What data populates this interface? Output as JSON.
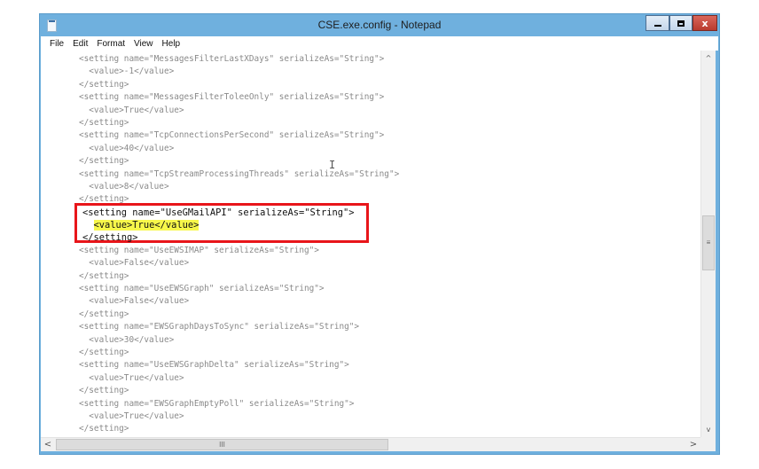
{
  "window": {
    "title": "CSE.exe.config - Notepad",
    "controls": {
      "minimize": "_",
      "maximize": "□",
      "close": "x"
    }
  },
  "menu": [
    "File",
    "Edit",
    "Format",
    "View",
    "Help"
  ],
  "editor": {
    "lines": [
      "<setting name=\"MessagesFilterLastXDays\" serializeAs=\"String\">",
      "  <value>-1</value>",
      "</setting>",
      "<setting name=\"MessagesFilterToleeOnly\" serializeAs=\"String\">",
      "  <value>True</value>",
      "</setting>",
      "<setting name=\"TcpConnectionsPerSecond\" serializeAs=\"String\">",
      "  <value>40</value>",
      "</setting>",
      "<setting name=\"TcpStreamProcessingThreads\" serializeAs=\"String\">",
      "  <value>8</value>",
      "</setting>",
      "",
      "",
      "",
      "<setting name=\"UseEWSIMAP\" serializeAs=\"String\">",
      "  <value>False</value>",
      "</setting>",
      "<setting name=\"UseEWSGraph\" serializeAs=\"String\">",
      "  <value>False</value>",
      "</setting>",
      "<setting name=\"EWSGraphDaysToSync\" serializeAs=\"String\">",
      "  <value>30</value>",
      "</setting>",
      "<setting name=\"UseEWSGraphDelta\" serializeAs=\"String\">",
      "  <value>True</value>",
      "</setting>",
      "<setting name=\"EWSGraphEmptyPoll\" serializeAs=\"String\">",
      "  <value>True</value>",
      "</setting>"
    ],
    "highlighted": {
      "line1": "<setting name=\"UseGMailAPI\" serializeAs=\"String\">",
      "line2_indent": "  ",
      "line2_value": "<value>True</value>",
      "line3": "</setting>"
    },
    "highlight_colors": {
      "box_border": "#e8151a",
      "text_highlight": "#f7f74a"
    }
  },
  "scrollbars": {
    "vertical": {
      "up": "^",
      "down": "v",
      "thumb_grip": "≡"
    },
    "horizontal": {
      "left": "<",
      "right": ">",
      "thumb_grip": "III"
    }
  }
}
